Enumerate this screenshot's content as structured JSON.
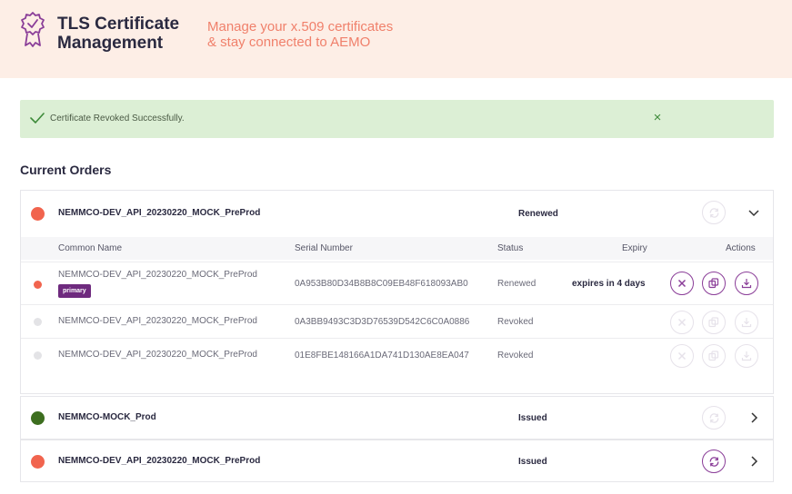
{
  "header": {
    "title_line1": "TLS Certificate",
    "title_line2": "Management",
    "tagline_line1": "Manage your x.509 certificates",
    "tagline_line2": "& stay connected to AEMO",
    "logo_icon": "certificate-badge-icon"
  },
  "alert": {
    "message": "Certificate Revoked Successfully.",
    "close_label": "×",
    "color": "#dcefd5"
  },
  "section": {
    "title": "Current Orders"
  },
  "table_headers": {
    "common_name": "Common Name",
    "serial_number": "Serial Number",
    "status": "Status",
    "expiry": "Expiry",
    "actions": "Actions"
  },
  "orders": [
    {
      "name": "NEMMCO-DEV_API_20230220_MOCK_PreProd",
      "status": "Renewed",
      "dot_color": "#f1644e",
      "expanded": true,
      "certificates": [
        {
          "common_name": "NEMMCO-DEV_API_20230220_MOCK_PreProd",
          "badge": "primary",
          "serial": "0A953B80D34B8B8C09EB48F618093AB0",
          "status": "Renewed",
          "expiry": "expires in 4 days",
          "dot_color": "#f1644e",
          "actions_enabled": true
        },
        {
          "common_name": "NEMMCO-DEV_API_20230220_MOCK_PreProd",
          "serial": "0A3BB9493C3D3D76539D542C6C0A0886",
          "status": "Revoked",
          "dot_color": "#e3e3e6",
          "actions_enabled": false
        },
        {
          "common_name": "NEMMCO-DEV_API_20230220_MOCK_PreProd",
          "serial": "01E8FBE148166A1DA741D130AE8EA047",
          "status": "Revoked",
          "dot_color": "#e3e3e6",
          "actions_enabled": false
        }
      ]
    },
    {
      "name": "NEMMCO-MOCK_Prod",
      "status": "Issued",
      "dot_color": "#3d6e1f",
      "expanded": false
    },
    {
      "name": "NEMMCO-DEV_API_20230220_MOCK_PreProd",
      "status": "Issued",
      "dot_color": "#f1644e",
      "expanded": false
    }
  ],
  "colors": {
    "header_bg": "#fdeee6",
    "accent_purple": "#8a3d98",
    "tagline": "#f0806b"
  }
}
